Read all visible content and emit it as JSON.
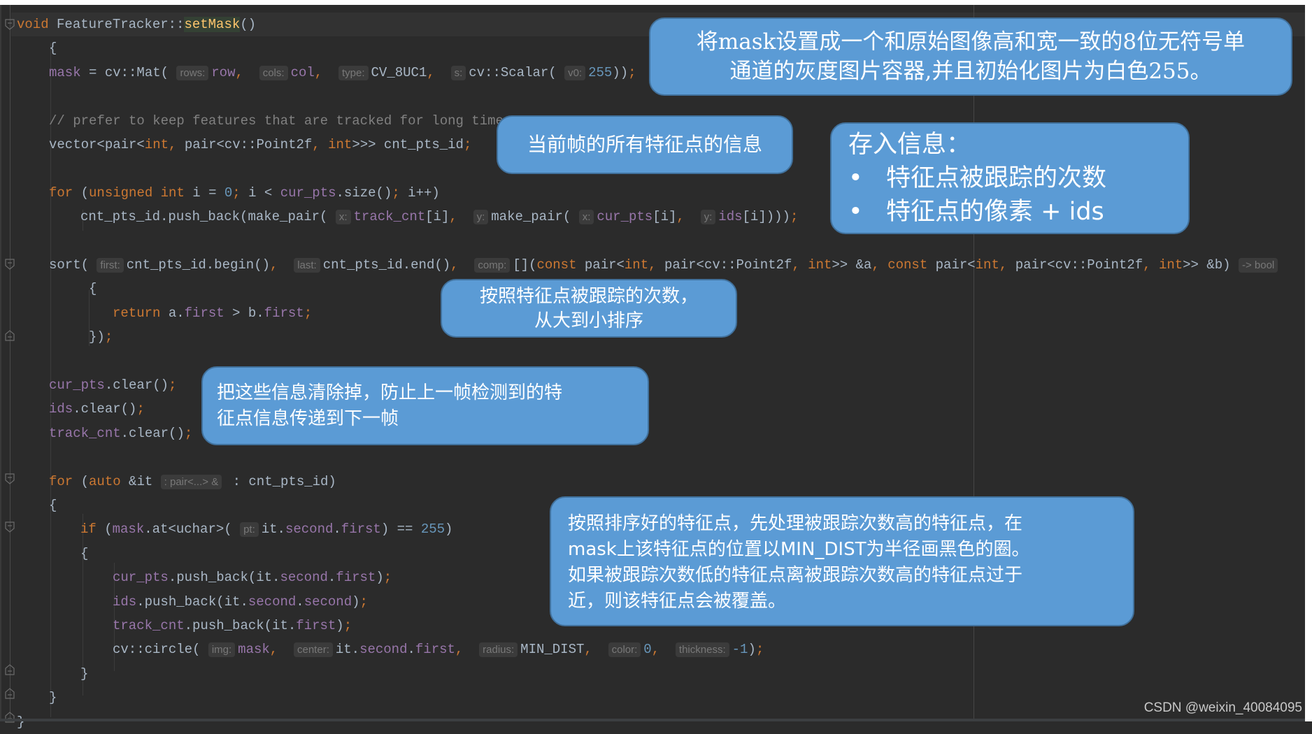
{
  "code": {
    "lines": [
      {
        "parts": [
          [
            "kw",
            "void"
          ],
          [
            "p",
            " FeatureTracker::"
          ],
          [
            "fnhl",
            "setMask"
          ],
          [
            "p",
            "()"
          ]
        ]
      },
      {
        "parts": [
          [
            "p",
            "{"
          ]
        ]
      },
      {
        "parts": [
          [
            "field",
            "mask"
          ],
          [
            "p",
            " = cv::Mat( "
          ],
          [
            "hint",
            "rows:"
          ],
          [
            "field",
            "row"
          ],
          [
            "kw",
            ", "
          ],
          [
            "p",
            " "
          ],
          [
            "hint",
            "cols:"
          ],
          [
            "field",
            "col"
          ],
          [
            "kw",
            ", "
          ],
          [
            "p",
            " "
          ],
          [
            "hint",
            "type:"
          ],
          [
            "p",
            "CV_8UC1"
          ],
          [
            "kw",
            ", "
          ],
          [
            "p",
            " "
          ],
          [
            "hint",
            "s:"
          ],
          [
            "p",
            "cv::Scalar( "
          ],
          [
            "hint",
            "v0:"
          ],
          [
            "num",
            "255"
          ],
          [
            "p",
            "))"
          ],
          [
            "kw",
            ";"
          ]
        ]
      },
      {
        "parts": []
      },
      {
        "parts": [
          [
            "cmt",
            "// prefer to keep features that are tracked for long time"
          ]
        ]
      },
      {
        "parts": [
          [
            "p",
            "vector<pair<"
          ],
          [
            "kw",
            "int"
          ],
          [
            "kw",
            ", "
          ],
          [
            "p",
            "pair<cv::Point2f"
          ],
          [
            "kw",
            ", "
          ],
          [
            "kw",
            "int"
          ],
          [
            "p",
            ">>> cnt_pts_id"
          ],
          [
            "kw",
            ";"
          ]
        ]
      },
      {
        "parts": []
      },
      {
        "parts": [
          [
            "kw",
            "for"
          ],
          [
            "p",
            " ("
          ],
          [
            "kw",
            "unsigned int"
          ],
          [
            "p",
            " i = "
          ],
          [
            "num",
            "0"
          ],
          [
            "kw",
            "; "
          ],
          [
            "p",
            "i < "
          ],
          [
            "field",
            "cur_pts"
          ],
          [
            "p",
            ".size()"
          ],
          [
            "kw",
            "; "
          ],
          [
            "p",
            "i++)"
          ]
        ]
      },
      {
        "parts": [
          [
            "p",
            "cnt_pts_id.push_back(make_pair( "
          ],
          [
            "hint",
            "x:"
          ],
          [
            "field",
            "track_cnt"
          ],
          [
            "p",
            "[i]"
          ],
          [
            "kw",
            ", "
          ],
          [
            "p",
            " "
          ],
          [
            "hint",
            "y:"
          ],
          [
            "p",
            "make_pair( "
          ],
          [
            "hint",
            "x:"
          ],
          [
            "field",
            "cur_pts"
          ],
          [
            "p",
            "[i]"
          ],
          [
            "kw",
            ", "
          ],
          [
            "p",
            " "
          ],
          [
            "hint",
            "y:"
          ],
          [
            "field",
            "ids"
          ],
          [
            "p",
            "[i])))"
          ],
          [
            "kw",
            ";"
          ]
        ]
      },
      {
        "parts": []
      },
      {
        "parts": [
          [
            "p",
            "sort( "
          ],
          [
            "hint",
            "first:"
          ],
          [
            "p",
            "cnt_pts_id.begin()"
          ],
          [
            "kw",
            ", "
          ],
          [
            "p",
            " "
          ],
          [
            "hint",
            "last:"
          ],
          [
            "p",
            "cnt_pts_id.end()"
          ],
          [
            "kw",
            ", "
          ],
          [
            "p",
            " "
          ],
          [
            "hint",
            "comp:"
          ],
          [
            "p",
            "[]("
          ],
          [
            "kw",
            "const "
          ],
          [
            "p",
            "pair<"
          ],
          [
            "kw",
            "int"
          ],
          [
            "kw",
            ", "
          ],
          [
            "p",
            "pair<cv::Point2f"
          ],
          [
            "kw",
            ", "
          ],
          [
            "kw",
            "int"
          ],
          [
            "p",
            ">> &a"
          ],
          [
            "kw",
            ", const "
          ],
          [
            "p",
            "pair<"
          ],
          [
            "kw",
            "int"
          ],
          [
            "kw",
            ", "
          ],
          [
            "p",
            "pair<cv::Point2f"
          ],
          [
            "kw",
            ", "
          ],
          [
            "kw",
            "int"
          ],
          [
            "p",
            ">> &b) "
          ],
          [
            "hint",
            "-> bool"
          ]
        ]
      },
      {
        "parts": [
          [
            "p",
            "{"
          ]
        ]
      },
      {
        "parts": [
          [
            "kw",
            "return "
          ],
          [
            "p",
            "a."
          ],
          [
            "field",
            "first"
          ],
          [
            "p",
            " > b."
          ],
          [
            "field",
            "first"
          ],
          [
            "kw",
            ";"
          ]
        ]
      },
      {
        "parts": [
          [
            "p",
            "})"
          ],
          [
            "kw",
            ";"
          ]
        ]
      },
      {
        "parts": []
      },
      {
        "parts": [
          [
            "field",
            "cur_pts"
          ],
          [
            "p",
            ".clear()"
          ],
          [
            "kw",
            ";"
          ]
        ]
      },
      {
        "parts": [
          [
            "field",
            "ids"
          ],
          [
            "p",
            ".clear()"
          ],
          [
            "kw",
            ";"
          ]
        ]
      },
      {
        "parts": [
          [
            "field",
            "track_cnt"
          ],
          [
            "p",
            ".clear()"
          ],
          [
            "kw",
            ";"
          ]
        ]
      },
      {
        "parts": []
      },
      {
        "parts": [
          [
            "kw",
            "for"
          ],
          [
            "p",
            " ("
          ],
          [
            "kw",
            "auto "
          ],
          [
            "p",
            "&it "
          ],
          [
            "hint",
            ": pair<...> &"
          ],
          [
            "p",
            " : cnt_pts_id)"
          ]
        ]
      },
      {
        "parts": [
          [
            "p",
            "{"
          ]
        ]
      },
      {
        "parts": [
          [
            "kw",
            "if"
          ],
          [
            "p",
            " ("
          ],
          [
            "field",
            "mask"
          ],
          [
            "p",
            ".at<uchar>( "
          ],
          [
            "hint",
            "pt:"
          ],
          [
            "p",
            "it."
          ],
          [
            "field",
            "second"
          ],
          [
            "p",
            "."
          ],
          [
            "field",
            "first"
          ],
          [
            "p",
            ") == "
          ],
          [
            "num",
            "255"
          ],
          [
            "p",
            ")"
          ]
        ]
      },
      {
        "parts": [
          [
            "p",
            "{"
          ]
        ]
      },
      {
        "parts": [
          [
            "field",
            "cur_pts"
          ],
          [
            "p",
            ".push_back(it."
          ],
          [
            "field",
            "second"
          ],
          [
            "p",
            "."
          ],
          [
            "field",
            "first"
          ],
          [
            "p",
            ")"
          ],
          [
            "kw",
            ";"
          ]
        ]
      },
      {
        "parts": [
          [
            "field",
            "ids"
          ],
          [
            "p",
            ".push_back(it."
          ],
          [
            "field",
            "second"
          ],
          [
            "p",
            "."
          ],
          [
            "field",
            "second"
          ],
          [
            "p",
            ")"
          ],
          [
            "kw",
            ";"
          ]
        ]
      },
      {
        "parts": [
          [
            "field",
            "track_cnt"
          ],
          [
            "p",
            ".push_back(it."
          ],
          [
            "field",
            "first"
          ],
          [
            "p",
            ")"
          ],
          [
            "kw",
            ";"
          ]
        ]
      },
      {
        "parts": [
          [
            "p",
            "cv::circle( "
          ],
          [
            "hint",
            "img:"
          ],
          [
            "field",
            "mask"
          ],
          [
            "kw",
            ", "
          ],
          [
            "p",
            " "
          ],
          [
            "hint",
            "center:"
          ],
          [
            "p",
            "it."
          ],
          [
            "field",
            "second"
          ],
          [
            "p",
            "."
          ],
          [
            "field",
            "first"
          ],
          [
            "kw",
            ", "
          ],
          [
            "p",
            " "
          ],
          [
            "hint",
            "radius:"
          ],
          [
            "p",
            "MIN_DIST"
          ],
          [
            "kw",
            ", "
          ],
          [
            "p",
            " "
          ],
          [
            "hint",
            "color:"
          ],
          [
            "num",
            "0"
          ],
          [
            "kw",
            ", "
          ],
          [
            "p",
            " "
          ],
          [
            "hint",
            "thickness:"
          ],
          [
            "num",
            "-1"
          ],
          [
            "p",
            ")"
          ],
          [
            "kw",
            ";"
          ]
        ]
      },
      {
        "parts": [
          [
            "p",
            "}"
          ]
        ]
      },
      {
        "parts": [
          [
            "p",
            "}"
          ]
        ]
      },
      {
        "parts": [
          [
            "p",
            "}"
          ]
        ]
      }
    ]
  },
  "callouts": {
    "mask_init": [
      "将mask设置成一个和原始图像高和宽一致的8位无符号单",
      "通道的灰度图片容器,并且初始化图片为白色255。"
    ],
    "current_frame": [
      "当前帧的所有特征点的信息"
    ],
    "store_info": {
      "title": "存入信息：",
      "bullets": [
        "特征点被跟踪的次数",
        "特征点的像素 + ids"
      ]
    },
    "sort_desc": [
      "按照特征点被跟踪的次数，",
      "从大到小排序"
    ],
    "clear_info": [
      "把这些信息清除掉，防止上一帧检测到的特",
      "征点信息传递到下一帧"
    ],
    "mask_process": [
      "按照排序好的特征点，先处理被跟踪次数高的特征点，在",
      "mask上该特征点的位置以MIN_DIST为半径画黑色的圈。",
      "如果被跟踪次数低的特征点离被跟踪次数高的特征点过于",
      "近，则该特征点会被覆盖。"
    ]
  },
  "watermark": "CSDN @weixin_40084095"
}
